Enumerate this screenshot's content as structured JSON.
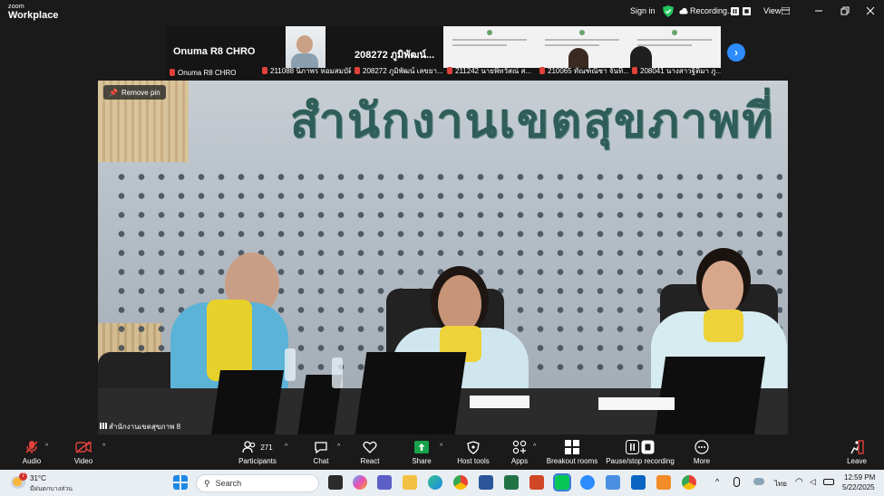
{
  "app": {
    "brand_small": "zoom",
    "brand_large": "Workplace"
  },
  "titlebar": {
    "sign_in": "Sign in",
    "recording": "Recording...",
    "view": "View"
  },
  "thumbnails": [
    {
      "big_name": "Onuma R8 CHRO",
      "label": "Onuma R8 CHRO",
      "kind": "name"
    },
    {
      "big_name": "",
      "label": "211088 นิภาพร หอมสมบัติ...",
      "kind": "video"
    },
    {
      "big_name": "208272 ภูมิพัฒน์...",
      "label": "208272 ภูมิพัฒน์ เลขยา...",
      "kind": "name"
    },
    {
      "big_name": "",
      "label": "211242 นายพิทวัสณ์ ส...",
      "kind": "slide"
    },
    {
      "big_name": "",
      "label": "210065 ทัณฑ์ณิชา จันทิ...",
      "kind": "slide"
    },
    {
      "big_name": "",
      "label": "208041 นางสาวฐิติมา ภู...",
      "kind": "slide"
    }
  ],
  "video": {
    "remove_pin": "Remove pin",
    "banner_text": "สำนักงานเขตสุขภาพที่",
    "location_label": "สำนักงานเขตสุขภาพ 8"
  },
  "toolbar": {
    "audio": "Audio",
    "video": "Video",
    "participants": "Participants",
    "participants_count": "271",
    "chat": "Chat",
    "react": "React",
    "share": "Share",
    "host_tools": "Host tools",
    "apps": "Apps",
    "breakout_rooms": "Breakout rooms",
    "pause_stop_recording": "Pause/stop recording",
    "more": "More",
    "leave": "Leave"
  },
  "taskbar": {
    "weather_temp": "31°C",
    "weather_desc": "มีฝนตกบางส่วน",
    "search_placeholder": "Search",
    "lang": "ไทย",
    "time": "12:59 PM",
    "date": "5/22/2025",
    "weather_badge": "7"
  },
  "colors": {
    "accent_blue": "#2d8cff",
    "record_green": "#22c55e",
    "mic_muted_red": "#e0413a",
    "share_green": "#16a34a"
  }
}
